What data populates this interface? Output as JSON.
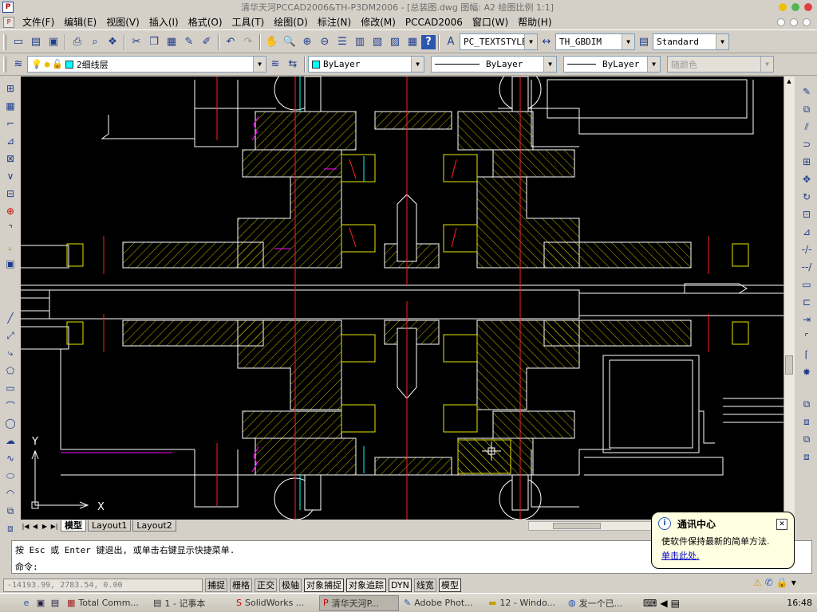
{
  "window": {
    "title": "清华天河PCCAD2006&TH-P3DM2006 - [总装图.dwg 图幅: A2 绘图比例 1:1]",
    "app_icon": "pccad-logo-icon"
  },
  "menu": {
    "items": [
      "文件(F)",
      "编辑(E)",
      "视图(V)",
      "插入(I)",
      "格式(O)",
      "工具(T)",
      "绘图(D)",
      "标注(N)",
      "修改(M)",
      "PCCAD2006",
      "窗口(W)",
      "帮助(H)"
    ]
  },
  "toolbar": {
    "text_style": "PC_TEXTSTYLE",
    "dim_style": "TH_GBDIM",
    "table_style": "Standard",
    "layer": "2细线层",
    "color": "ByLayer",
    "linetype": "ByLayer",
    "lineweight": "ByLayer",
    "plot_style": "随颜色"
  },
  "drawing": {
    "ucs_x": "X",
    "ucs_y": "Y",
    "colors": {
      "outline": "#ffffff",
      "hatch": "#e6e600",
      "center": "#ff2020",
      "bearing": "#e6e600",
      "accent": "#ff00ff",
      "cyan": "#00ffff"
    }
  },
  "layout_tabs": [
    "模型",
    "Layout1",
    "Layout2"
  ],
  "command": {
    "line1": "按 Esc 或 Enter 键退出, 或单击右键显示快捷菜单.",
    "prompt": "命令:"
  },
  "status": {
    "coords": "-14193.99, 2783.54, 0.00",
    "toggles": [
      "捕捉",
      "栅格",
      "正交",
      "极轴",
      "对象捕捉",
      "对象追踪",
      "DYN",
      "线宽",
      "模型"
    ],
    "active": [
      "对象捕捉",
      "对象追踪",
      "DYN",
      "模型"
    ]
  },
  "balloon": {
    "title": "通讯中心",
    "body": "使软件保持最新的简单方法.",
    "link": "单击此处."
  },
  "taskbar": {
    "tasks": [
      "Total Comm...",
      "1 - 记事本",
      "SolidWorks ...",
      "清华天河P...",
      "Adobe Phot...",
      "12 - Windo...",
      "发一个已..."
    ],
    "active_task": "清华天河P...",
    "clock": "16:48"
  }
}
